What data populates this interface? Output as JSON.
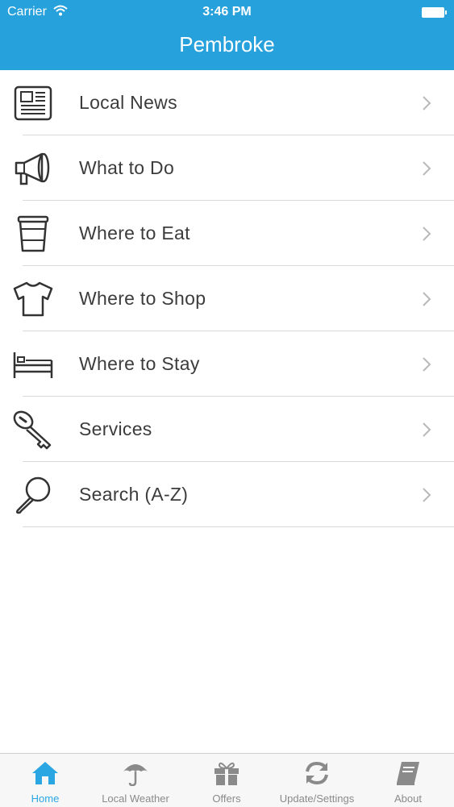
{
  "status_bar": {
    "carrier": "Carrier",
    "time": "3:46 PM"
  },
  "header": {
    "title": "Pembroke"
  },
  "menu": [
    {
      "label": "Local News",
      "icon": "newspaper-icon"
    },
    {
      "label": "What to Do",
      "icon": "megaphone-icon"
    },
    {
      "label": "Where to Eat",
      "icon": "coffee-cup-icon"
    },
    {
      "label": "Where to Shop",
      "icon": "tshirt-icon"
    },
    {
      "label": "Where to Stay",
      "icon": "bed-icon"
    },
    {
      "label": "Services",
      "icon": "key-icon"
    },
    {
      "label": "Search (A-Z)",
      "icon": "magnifier-icon"
    }
  ],
  "tabs": [
    {
      "label": "Home",
      "icon": "home-icon",
      "active": true
    },
    {
      "label": "Local Weather",
      "icon": "umbrella-icon",
      "active": false
    },
    {
      "label": "Offers",
      "icon": "gift-icon",
      "active": false
    },
    {
      "label": "Update/Settings",
      "icon": "refresh-icon",
      "active": false
    },
    {
      "label": "About",
      "icon": "book-icon",
      "active": false
    }
  ],
  "colors": {
    "header": "#27a1db",
    "active_tab": "#2aa7e3",
    "inactive_tab": "#8a8a8a",
    "text": "#3c3c3c"
  }
}
